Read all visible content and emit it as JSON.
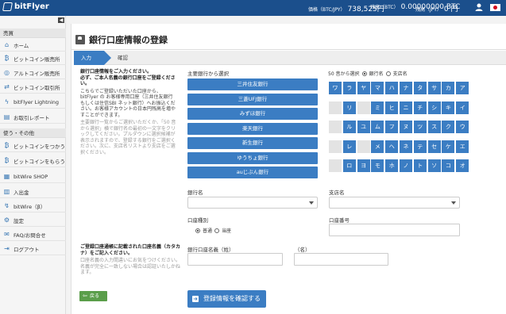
{
  "header": {
    "logo_text": "bitFlyer",
    "stat1_label": "価格（BTC/JPY）",
    "stat1_value": "738,525円",
    "stat2_label": "残高（BTC）",
    "stat2_value": "0.00000000 BTC",
    "stat3_label": "残高（JPY）",
    "stat3_value": "0 円",
    "icons": [
      "user-icon",
      "japan-flag-icon"
    ]
  },
  "sidebar": {
    "section1": "売買",
    "items1": [
      {
        "label": "ホーム",
        "icon": "home-icon"
      },
      {
        "label": "ビットコイン販売所",
        "icon": "bitcoin-icon"
      },
      {
        "label": "アルトコイン販売所",
        "icon": "coin-icon"
      },
      {
        "label": "ビットコイン取引所",
        "icon": "exchange-icon"
      },
      {
        "label": "bitFlyer Lightning",
        "icon": "lightning-icon"
      },
      {
        "label": "お取引レポート",
        "icon": "report-icon"
      }
    ],
    "section2": "使う・その他",
    "items2": [
      {
        "label": "ビットコインをつかう",
        "icon": "bitcoin-icon"
      },
      {
        "label": "ビットコインをもらう",
        "icon": "bitcoin-icon"
      },
      {
        "label": "bitWire SHOP",
        "icon": "shop-icon"
      },
      {
        "label": "入出金",
        "icon": "bank-icon"
      },
      {
        "label": "bitWire（β）",
        "icon": "bitwire-icon"
      },
      {
        "label": "設定",
        "icon": "gear-icon"
      },
      {
        "label": "FAQ/お問合せ",
        "icon": "mail-icon"
      },
      {
        "label": "ログアウト",
        "icon": "logout-icon"
      }
    ]
  },
  "main": {
    "title": "銀行口座情報の登録",
    "step_active": "入力",
    "step_next": "確認",
    "intro_line1": "銀行口座情報をご入力ください。",
    "intro_line2": "必ず、ご本人名義の銀行口座をご登録ください。",
    "intro_note": "こちらでご登録いただいた口座から、bitFlyer の お客様専用口座（三井住友銀行もしくは住信SBI ネット銀行）へお振込ください。お客様アカウントの日本円残高を増やすことができます。",
    "intro_muted": "主要銀行一覧からご選択いただくか、「50 音から選択」横で銀行名の最初の一文字をクリックしてください。プルダウンに選択候補が表示されますので、登録する銀行をご選択ください。次に、支店名リストより支店をご選択ください。",
    "bank_heading": "主要銀行から選択",
    "banks": [
      "三井住友銀行",
      "三菱UFJ銀行",
      "みずほ銀行",
      "楽天銀行",
      "新生銀行",
      "ゆうちょ銀行",
      "auじぶん銀行"
    ],
    "kana_heading": "50 音から選択",
    "kana_radio1": "銀行名",
    "kana_radio2": "支店名",
    "kana_rows": [
      [
        "ワ",
        "ラ",
        "ヤ",
        "マ",
        "ハ",
        "ナ",
        "タ",
        "サ",
        "カ",
        "ア"
      ],
      [
        "",
        "リ",
        "",
        "ミ",
        "ヒ",
        "ニ",
        "チ",
        "シ",
        "キ",
        "イ"
      ],
      [
        "",
        "ル",
        "ユ",
        "ム",
        "フ",
        "ヌ",
        "ツ",
        "ス",
        "ク",
        "ウ"
      ],
      [
        "",
        "レ",
        "",
        "メ",
        "ヘ",
        "ネ",
        "テ",
        "セ",
        "ケ",
        "エ"
      ],
      [
        "",
        "ロ",
        "ヨ",
        "モ",
        "ホ",
        "ノ",
        "ト",
        "ソ",
        "コ",
        "オ"
      ]
    ],
    "bank_name_label": "銀行名",
    "branch_label": "支店名",
    "account_type_label": "口座種別",
    "account_type_opt1": "普通",
    "account_type_opt2": "当座",
    "account_number_label": "口座番号",
    "holder_heading": "ご登録口座通帳に記載された口座名義（カタカナ）をご記入ください。",
    "holder_note": "口座名義の入力間違いにお気をつけください。名義が完全に一致しない場合は認証いたしかねます。",
    "holder_last_label": "銀行口座名義（姓）",
    "holder_first_label": "（名）",
    "back_label": "戻る",
    "confirm_label": "登録情報を確認する"
  }
}
